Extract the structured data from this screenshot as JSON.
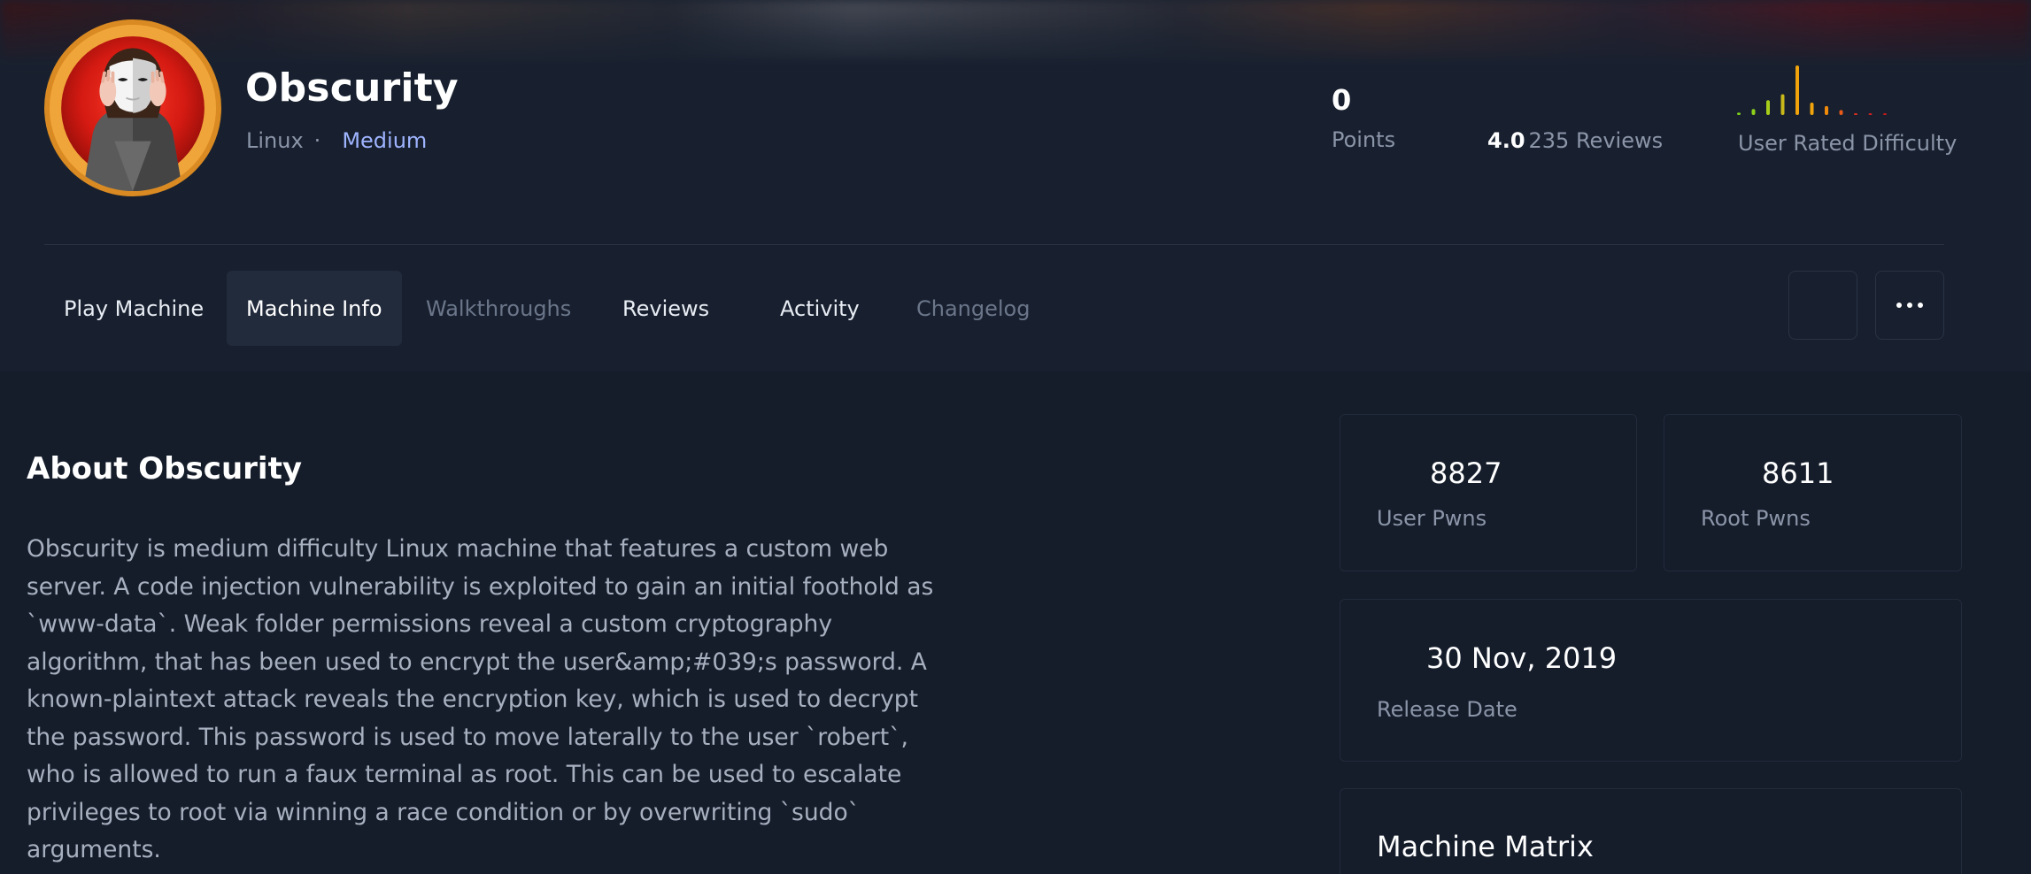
{
  "machine": {
    "name": "Obscurity",
    "os": "Linux",
    "difficulty": "Medium"
  },
  "stats": {
    "points_value": "0",
    "points_label": "Points",
    "rating": "4.0",
    "reviews": "235 Reviews",
    "difficulty_label": "User Rated Difficulty",
    "difficulty_distribution": [
      0.05,
      0.12,
      0.3,
      0.42,
      1.0,
      0.25,
      0.18,
      0.1,
      0.03,
      0.03,
      0.03
    ]
  },
  "tabs": [
    {
      "label": "Play Machine",
      "state": "normal"
    },
    {
      "label": "Machine Info",
      "state": "active"
    },
    {
      "label": "Walkthroughs",
      "state": "muted"
    },
    {
      "label": "Reviews",
      "state": "normal"
    },
    {
      "label": "Activity",
      "state": "normal"
    },
    {
      "label": "Changelog",
      "state": "muted"
    }
  ],
  "about": {
    "title": "About Obscurity",
    "description": "Obscurity is medium difficulty Linux machine that features a custom web server. A code injection vulnerability is exploited to gain an initial foothold as `www-data`. Weak folder permissions reveal a custom cryptography algorithm, that has been used to encrypt the user&amp;#039;s password. A known-plaintext attack reveals the encryption key, which is used to decrypt the password. This password is used to move laterally to the user `robert`, who is allowed to run a faux terminal as root. This can be used to escalate privileges to root via winning a race condition or by overwriting `sudo` arguments."
  },
  "cards": {
    "user_pwns_value": "8827",
    "user_pwns_label": "User Pwns",
    "root_pwns_value": "8611",
    "root_pwns_label": "Root Pwns",
    "release_date_value": "30 Nov, 2019",
    "release_date_label": "Release Date",
    "matrix_title": "Machine Matrix"
  },
  "colors": {
    "background": "#151d2b",
    "header": "#18202f",
    "difficulty_accent": "#9fb4ff",
    "muted_text": "#8b95a8",
    "avatar_ring": "#f0a53a",
    "avatar_red": "#d41a12"
  }
}
